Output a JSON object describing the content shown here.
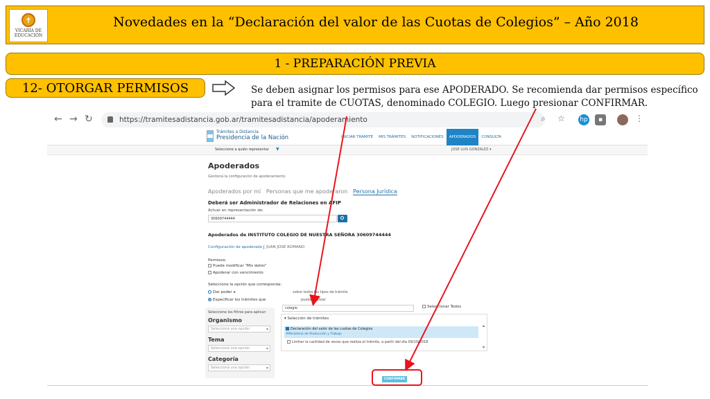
{
  "slide": {
    "logo_text": "VICARÍA DE EDUCACIÓN",
    "title": "Novedades en la “Declaración del valor de las Cuotas de Colegios” – Año 2018",
    "section": "1 - PREPARACIÓN PREVIA",
    "step": "12- OTORGAR PERMISOS",
    "instruction_line1": "Se deben asignar los permisos para ese APODERADO. Se recomienda dar permisos específico",
    "instruction_line2_a": "para el tramite de CUOTAS, denominado COLEGIO. Luego presionar ",
    "instruction_line2_b": "CONFIRMAR."
  },
  "browser": {
    "url": "https://tramitesadistancia.gob.ar/tramitesadistancia/apoderamiento"
  },
  "site": {
    "logo_line1": "Trámites a Distancia",
    "logo_line2": "Presidencia de la Nación",
    "nav": [
      "INICIAR TRÁMITE",
      "MIS TRÁMITES",
      "NOTIFICACIONES",
      "APODERADOS",
      "CONSULTA"
    ],
    "representar": "Seleccione a quién representar",
    "user": "JOSE LUIS GONZALEZ ▾"
  },
  "page": {
    "heading": "Apoderados",
    "subheading": "Gestioná la configuración de apoderamiento",
    "tab1": "Apoderados por mí",
    "tab2": "Personas que me apoderaron",
    "tab3": "Persona Jurídica",
    "must_be": "Deberá ser Administrador de Relaciones en AFIP",
    "actuar": "Actuar en representación de:",
    "cuit_value": "30609744444",
    "apoderados_title": "Apoderados de INSTITUTO COLEGIO DE NUESTRA SEÑORA 30609744444",
    "config_link": "Configuración de apoderado",
    "config_person": "JUAN JOSE ROMANO",
    "permisos_label": "Permisos:",
    "perm1": "Puede modificar \"Mis datos\"",
    "perm2": "Apoderar con vencimiento",
    "option_label": "Seleccione la opción que corresponda:",
    "radio1": "Dar poder a",
    "radio1_tail": "sobre todos los tipos de trámite",
    "radio2": "Especificar los trámites que",
    "radio2_tail": "puede realizar",
    "filter_hint": "Seleccione los filtros para aplicar:",
    "organismo": "Organismo",
    "tema": "Tema",
    "categoria": "Categoría",
    "select_placeholder": "Seleccioná una opción",
    "search_value": "colegio",
    "select_all": "Seleccionar Todos",
    "tramites_header": "Selección de trámites",
    "tramite_name": "Declaración del valor de las cuotas de Colegios",
    "tramite_org": "#Ministerio de Producción y Trabajo",
    "limit_text": "Limitar la cantidad de veces que realiza el trámite, a partir del día 09/10/2018",
    "confirm": "CONFIRMAR"
  },
  "colors": {
    "banner": "#ffc000",
    "link_blue": "#1e6fa8",
    "arrow_red": "#e8141c",
    "confirm_button": "#5bc0de"
  }
}
